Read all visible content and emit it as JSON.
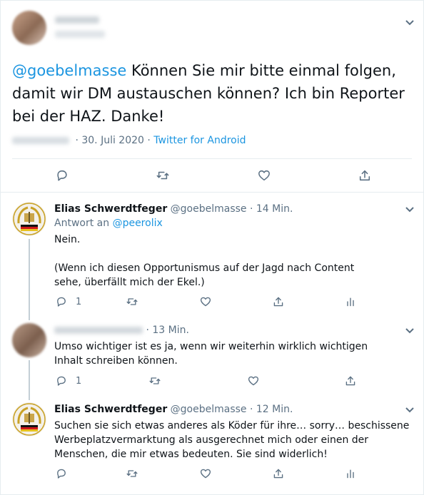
{
  "main_tweet": {
    "mention": "@goebelmasse",
    "text": " Können Sie mir bitte einmal folgen, damit wir DM austauschen können? Ich bin Reporter bei der HAZ. Danke!",
    "date": "· 30. Juli 2020 ·",
    "source": "Twitter for Android"
  },
  "replies": [
    {
      "name": "Elias Schwerdtfeger",
      "handle": "@goebelmasse",
      "time": "· 14 Min.",
      "reply_prefix": "Antwort an",
      "reply_to": "@peerolix",
      "line1": "Nein.",
      "line2": "(Wenn ich diesen Opportunismus auf der Jagd nach Content sehe, überfällt mich der Ekel.)",
      "reply_count": "1"
    },
    {
      "time": "· 13 Min.",
      "text": "Umso wichtiger ist es ja, wenn wir weiterhin wirklich wichtigen Inhalt schreiben können.",
      "reply_count": "1"
    },
    {
      "name": "Elias Schwerdtfeger",
      "handle": "@goebelmasse",
      "time": "· 12 Min.",
      "text": "Suchen sie sich etwas anderes als Köder für ihre… sorry… beschissene Werbeplatzvermarktung als ausgerechnet mich oder einen der Menschen, die mir etwas bedeuten. Sie sind widerlich!"
    }
  ],
  "colors": {
    "link": "#1b95e0",
    "muted": "#5b7083",
    "border": "#e6ecf0"
  }
}
